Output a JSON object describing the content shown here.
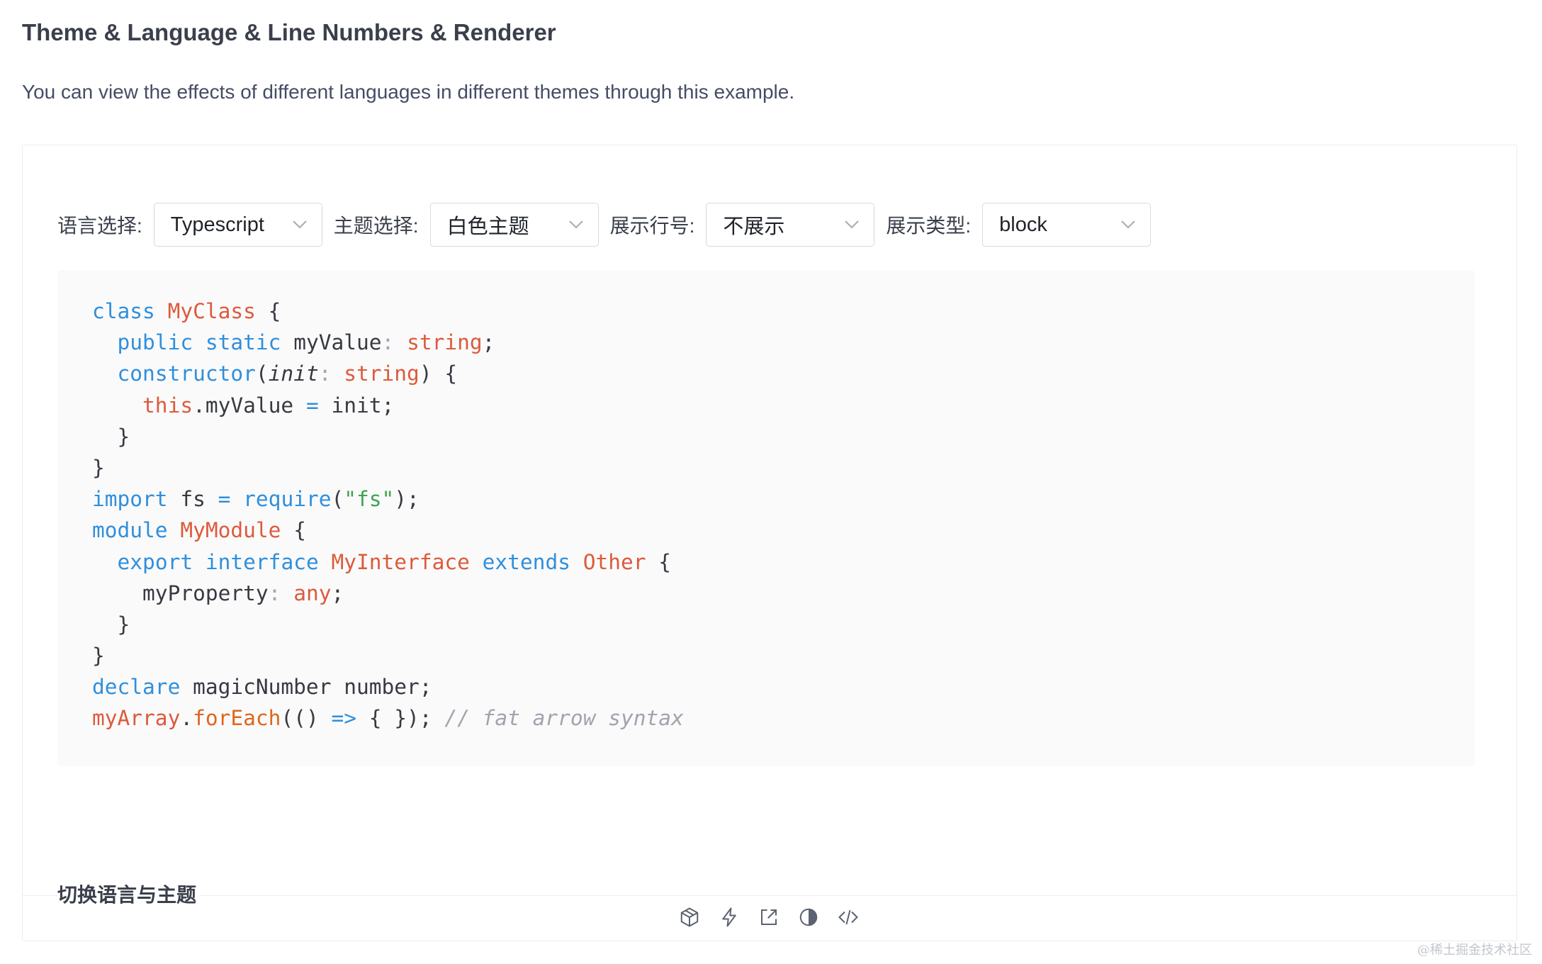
{
  "page": {
    "title": "Theme & Language & Line Numbers & Renderer",
    "description": "You can view the effects of different languages in different themes through this example."
  },
  "controls": [
    {
      "label": "语言选择:",
      "value": "Typescript"
    },
    {
      "label": "主题选择:",
      "value": "白色主题"
    },
    {
      "label": "展示行号:",
      "value": "不展示"
    },
    {
      "label": "展示类型:",
      "value": "block"
    }
  ],
  "code": {
    "language": "typescript",
    "lines": [
      [
        [
          "kw",
          "class"
        ],
        [
          "pu",
          " "
        ],
        [
          "ty",
          "MyClass"
        ],
        [
          "pu",
          " {"
        ]
      ],
      [
        [
          "pu",
          "  "
        ],
        [
          "kw",
          "public"
        ],
        [
          "pu",
          " "
        ],
        [
          "kw",
          "static"
        ],
        [
          "pu",
          " myValue"
        ],
        [
          "muted",
          ":"
        ],
        [
          "pu",
          " "
        ],
        [
          "ty",
          "string"
        ],
        [
          "pu",
          ";"
        ]
      ],
      [
        [
          "pu",
          "  "
        ],
        [
          "kw",
          "constructor"
        ],
        [
          "pu",
          "("
        ],
        [
          "it",
          "init"
        ],
        [
          "muted",
          ":"
        ],
        [
          "pu",
          " "
        ],
        [
          "ty",
          "string"
        ],
        [
          "pu",
          ") {"
        ]
      ],
      [
        [
          "pu",
          "    "
        ],
        [
          "ty",
          "this"
        ],
        [
          "pu",
          ".myValue "
        ],
        [
          "op",
          "="
        ],
        [
          "pu",
          " init;"
        ]
      ],
      [
        [
          "pu",
          "  }"
        ]
      ],
      [
        [
          "pu",
          "}"
        ]
      ],
      [
        [
          "kw",
          "import"
        ],
        [
          "pu",
          " fs "
        ],
        [
          "op",
          "="
        ],
        [
          "pu",
          " "
        ],
        [
          "kw",
          "require"
        ],
        [
          "pu",
          "("
        ],
        [
          "str",
          "\"fs\""
        ],
        [
          "pu",
          ");"
        ]
      ],
      [
        [
          "kw",
          "module"
        ],
        [
          "pu",
          " "
        ],
        [
          "ty",
          "MyModule"
        ],
        [
          "pu",
          " {"
        ]
      ],
      [
        [
          "pu",
          "  "
        ],
        [
          "kw",
          "export"
        ],
        [
          "pu",
          " "
        ],
        [
          "kw",
          "interface"
        ],
        [
          "pu",
          " "
        ],
        [
          "ty",
          "MyInterface"
        ],
        [
          "pu",
          " "
        ],
        [
          "kw",
          "extends"
        ],
        [
          "pu",
          " "
        ],
        [
          "ty",
          "Other"
        ],
        [
          "pu",
          " {"
        ]
      ],
      [
        [
          "pu",
          "    myProperty"
        ],
        [
          "muted",
          ":"
        ],
        [
          "pu",
          " "
        ],
        [
          "ty",
          "any"
        ],
        [
          "pu",
          ";"
        ]
      ],
      [
        [
          "pu",
          "  }"
        ]
      ],
      [
        [
          "pu",
          "}"
        ]
      ],
      [
        [
          "kw",
          "declare"
        ],
        [
          "pu",
          " magicNumber number;"
        ]
      ],
      [
        [
          "ty",
          "myArray"
        ],
        [
          "pu",
          "."
        ],
        [
          "fn",
          "forEach"
        ],
        [
          "pu",
          "(() "
        ],
        [
          "op",
          "=>"
        ],
        [
          "pu",
          " { }); "
        ],
        [
          "cm",
          "// fat arrow syntax"
        ]
      ]
    ]
  },
  "demo": {
    "caption": "切换语言与主题",
    "actions": [
      {
        "name": "codesandbox-icon"
      },
      {
        "name": "stackblitz-icon"
      },
      {
        "name": "open-external-icon"
      },
      {
        "name": "theme-contrast-icon"
      },
      {
        "name": "show-code-icon"
      }
    ]
  },
  "watermark": "@稀土掘金技术社区",
  "colors": {
    "keyword": "#2f8fdd",
    "type": "#dd5a3c",
    "string": "#3ea453",
    "comment": "#a0a4ad",
    "function": "#e0651c",
    "code_background": "#fafafa"
  }
}
